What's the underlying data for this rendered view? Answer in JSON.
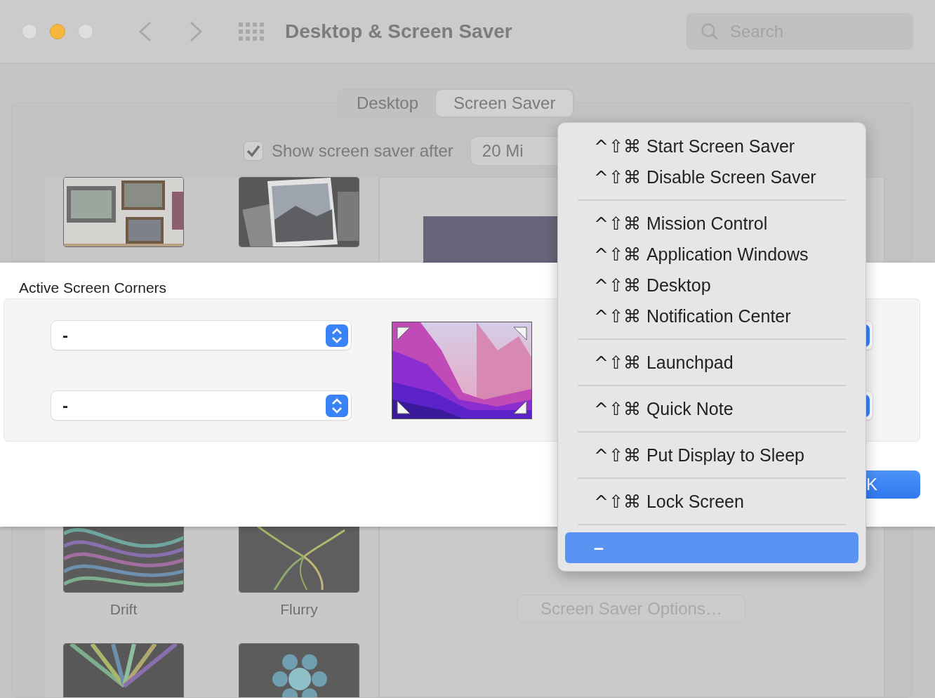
{
  "window": {
    "title": "Desktop & Screen Saver",
    "search": {
      "placeholder": "Search"
    }
  },
  "tabs": [
    {
      "label": "Desktop",
      "selected": false
    },
    {
      "label": "Screen Saver",
      "selected": true
    }
  ],
  "screen_saver": {
    "show_after": {
      "label": "Show screen saver after",
      "checked": true
    },
    "delay": "20 Mi",
    "savers": [
      {
        "kind": "picture"
      },
      {
        "kind": "picture"
      },
      {
        "kind": "picture",
        "label": "Drift"
      },
      {
        "kind": "picture",
        "label": "Flurry"
      },
      {
        "kind": "picture"
      },
      {
        "kind": "picture"
      }
    ],
    "options_button": {
      "label": "Screen Saver Options…",
      "disabled": true
    }
  },
  "sheet": {
    "title": "Active Screen Corners",
    "corners": [
      {
        "value": "-"
      },
      {
        "value": "-"
      }
    ],
    "ok_button": "K"
  },
  "menu": {
    "groups": [
      [
        {
          "shortcut": "^⇧⌘",
          "label": "Start Screen Saver",
          "selected": false
        },
        {
          "shortcut": "^⇧⌘",
          "label": "Disable Screen Saver",
          "selected": false
        }
      ],
      [
        {
          "shortcut": "^⇧⌘",
          "label": "Mission Control",
          "selected": false
        },
        {
          "shortcut": "^⇧⌘",
          "label": "Application Windows",
          "selected": false
        },
        {
          "shortcut": "^⇧⌘",
          "label": "Desktop",
          "selected": false
        },
        {
          "shortcut": "^⇧⌘",
          "label": "Notification Center",
          "selected": false
        }
      ],
      [
        {
          "shortcut": "^⇧⌘",
          "label": "Launchpad",
          "selected": false
        }
      ],
      [
        {
          "shortcut": "^⇧⌘",
          "label": "Quick Note",
          "selected": false
        }
      ],
      [
        {
          "shortcut": "^⇧⌘",
          "label": "Put Display to Sleep",
          "selected": false
        }
      ],
      [
        {
          "shortcut": "^⇧⌘",
          "label": "Lock Screen",
          "selected": false
        }
      ],
      [
        {
          "label": "–",
          "selected": true
        }
      ]
    ]
  }
}
